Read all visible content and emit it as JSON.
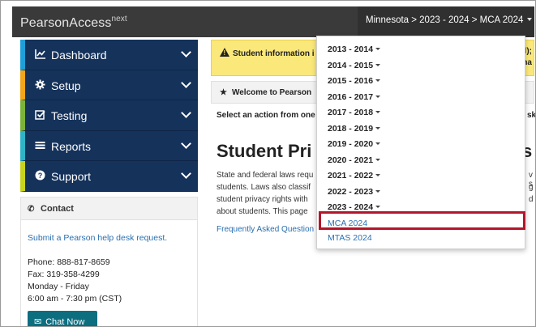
{
  "header": {
    "brand": "PearsonAccess",
    "brand_sup": "next",
    "context": "Minnesota > 2023 - 2024 > MCA 2024"
  },
  "sidebar": {
    "items": [
      {
        "label": "Dashboard",
        "icon": "chart-line-icon",
        "accent": "#1f9fd8"
      },
      {
        "label": "Setup",
        "icon": "gear-icon",
        "accent": "#f2a51a"
      },
      {
        "label": "Testing",
        "icon": "checkbox-icon",
        "accent": "#7bb33a"
      },
      {
        "label": "Reports",
        "icon": "list-icon",
        "accent": "#2fb3c7"
      },
      {
        "label": "Support",
        "icon": "question-circle-icon",
        "accent": "#c6d41e"
      }
    ]
  },
  "contact": {
    "title": "Contact",
    "help_link": "Submit a Pearson help desk request.",
    "phone": "Phone: 888-817-8659",
    "fax": "Fax: 319-358-4299",
    "days": "Monday - Friday",
    "hours": "6:00 am - 7:30 pm (CST)",
    "chat_button": "Chat Now"
  },
  "main": {
    "alert_text": "Student information i",
    "alert_right_1": "ll);",
    "alert_right_2": "na",
    "welcome": "Welcome to Pearson",
    "select_text": "Select an action from one",
    "select_right": "sk",
    "title": "Student Pri",
    "title_right": "s",
    "body_lines": [
      "State and federal laws requ",
      "students. Laws also classif",
      "student privacy rights with",
      "about students. This page"
    ],
    "body_right": [
      "v s",
      "g",
      "d",
      ""
    ],
    "faq_link": "Frequently Asked Question"
  },
  "dropdown": {
    "years": [
      "2013 - 2014",
      "2014 - 2015",
      "2015 - 2016",
      "2016 - 2017",
      "2017 - 2018",
      "2018 - 2019",
      "2019 - 2020",
      "2020 - 2021",
      "2021 - 2022",
      "2022 - 2023",
      "2023 - 2024"
    ],
    "tests": [
      "MCA 2024",
      "MTAS 2024"
    ],
    "selected_test": "MCA 2024"
  },
  "colors": {
    "nav_bg": "#15325b",
    "topbar": "#3a3a3a",
    "alert": "#fbe87a",
    "link": "#2a6fb0",
    "highlight": "#b3162b",
    "chat": "#0d6e80"
  }
}
